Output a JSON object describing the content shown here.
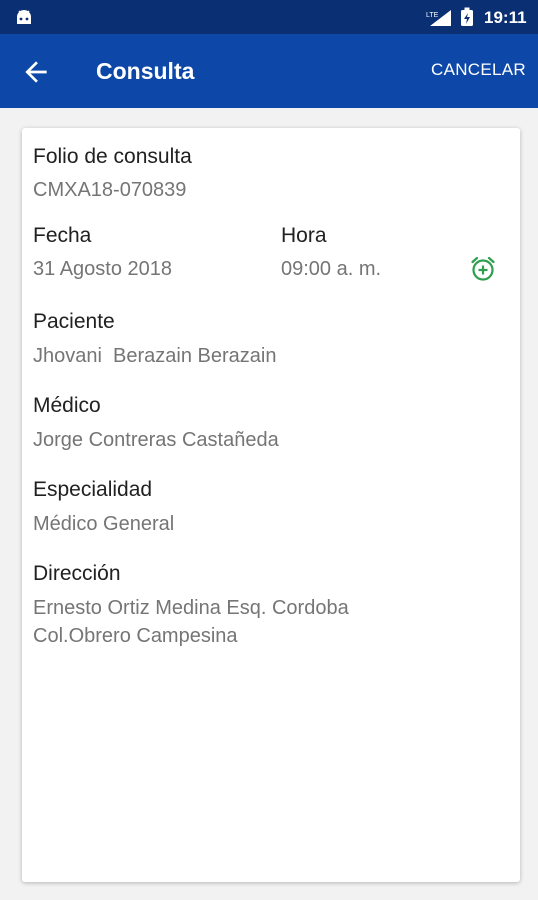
{
  "status_bar": {
    "time": "19:11",
    "network": "LTE"
  },
  "app_bar": {
    "title": "Consulta",
    "cancel_label": "CANCELAR"
  },
  "consulta": {
    "folio_label": "Folio de consulta",
    "folio_value": "CMXA18-070839",
    "fecha_label": "Fecha",
    "fecha_value": "31 Agosto 2018",
    "hora_label": "Hora",
    "hora_value": "09:00 a. m.",
    "paciente_label": "Paciente",
    "paciente_value": "Jhovani  Berazain Berazain",
    "medico_label": "Médico",
    "medico_value": "Jorge Contreras Castañeda",
    "especialidad_label": "Especialidad",
    "especialidad_value": "Médico General",
    "direccion_label": "Dirección",
    "direccion_line1": "Ernesto Ortiz Medina Esq. Cordoba",
    "direccion_line2": "Col.Obrero Campesina"
  },
  "colors": {
    "status_bar": "#0a2f73",
    "app_bar": "#0d48a8",
    "alarm_icon": "#2e9e4f"
  },
  "icons": [
    "android-icon",
    "signal-icon",
    "battery-icon",
    "back-arrow-icon",
    "alarm-add-icon"
  ]
}
